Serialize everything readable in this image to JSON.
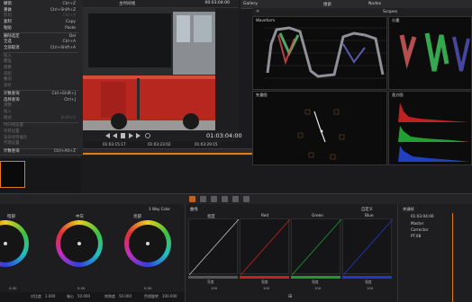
{
  "menu": {
    "items": [
      {
        "label": "撤销",
        "shortcut": "Ctrl+Z",
        "disabled": false
      },
      {
        "label": "重做",
        "shortcut": "Ctrl+Shift+Z",
        "disabled": false
      },
      {
        "label": "剪切",
        "shortcut": "Ctrl+X",
        "disabled": true
      },
      {
        "label": "复制",
        "shortcut": "Copy",
        "disabled": false
      },
      {
        "label": "粘贴",
        "shortcut": "Paste",
        "disabled": false
      },
      {
        "label": "删除选定",
        "shortcut": "Del",
        "disabled": false
      },
      {
        "label": "全选",
        "shortcut": "Ctrl+A",
        "disabled": false
      },
      {
        "label": "全部取消",
        "shortcut": "Ctrl+Shift+A",
        "disabled": false
      },
      {
        "label": "插入",
        "shortcut": "",
        "disabled": true
      },
      {
        "label": "覆盖",
        "shortcut": "",
        "disabled": true
      },
      {
        "label": "替换",
        "shortcut": "",
        "disabled": true
      },
      {
        "label": "适配",
        "shortcut": "",
        "disabled": true
      },
      {
        "label": "叠加",
        "shortcut": "",
        "disabled": true
      },
      {
        "label": "波纹",
        "shortcut": "",
        "disabled": true
      },
      {
        "label": "计数查询",
        "shortcut": "Ctrl+Shift+J",
        "disabled": false
      },
      {
        "label": "选择查询",
        "shortcut": "Ctrl+J",
        "disabled": false
      },
      {
        "label": "调整",
        "shortcut": "",
        "disabled": true
      },
      {
        "label": "插入",
        "shortcut": "",
        "disabled": true
      },
      {
        "label": "模式",
        "shortcut": "Shift+V",
        "disabled": true
      },
      {
        "label": "时间线设置",
        "shortcut": "",
        "disabled": true
      },
      {
        "label": "项目设置",
        "shortcut": "",
        "disabled": true
      },
      {
        "label": "渲染项目缓存",
        "shortcut": "",
        "disabled": true
      },
      {
        "label": "代理设置",
        "shortcut": "",
        "disabled": true
      },
      {
        "label": "计数查询",
        "shortcut": "Ctrl+Alt+Z",
        "disabled": false
      }
    ]
  },
  "viewer": {
    "title": "主时间线",
    "timecode": "00:03:04:00",
    "big_timecode": "01:03:04:00",
    "tc_left": "01:03:15:17",
    "tc_mid": "01:03:23:02",
    "tc_right": "01:03:29:15"
  },
  "panels": {
    "gallery_tab": "Gallery",
    "search": "搜索",
    "nodes_tab": "Nodes",
    "scopes_tab": "Scopes"
  },
  "scopes": {
    "waveform_title": "Waveform",
    "parade_title": "分量",
    "vectorscope_title": "矢量图",
    "histogram_title": "直方图"
  },
  "wheels": {
    "mode": "3 Way Color",
    "labels": [
      "暗部",
      "中灰",
      "亮部"
    ],
    "values": [
      "0.00",
      "0.00",
      "0.00"
    ],
    "bottom": {
      "contrast_label": "对比度",
      "contrast": "1.000",
      "pivot_label": "轴心",
      "pivot": "50.000",
      "sat_label": "饱和度",
      "sat": "50.000",
      "hue_label": "色相旋转",
      "hue": "100.000"
    }
  },
  "curves": {
    "title": "曲线",
    "labels": [
      "亮度",
      "Red",
      "Green",
      "Blue"
    ],
    "custom": "自定义",
    "values": [
      "100",
      "100",
      "100",
      "100"
    ],
    "bar_labels": [
      "亮度",
      "强度",
      "强度",
      "强度"
    ]
  },
  "nodes": {
    "title": "关键帧",
    "timecode": "01:03:04:00",
    "rows": [
      "Master",
      "Corrector",
      "PT.08"
    ],
    "marker": "00:00:00:00"
  },
  "colors": {
    "red_bar": "#c8201c",
    "green_bar": "#1e9a2e",
    "blue_bar": "#2438c8",
    "accent": "#e07a1a"
  }
}
